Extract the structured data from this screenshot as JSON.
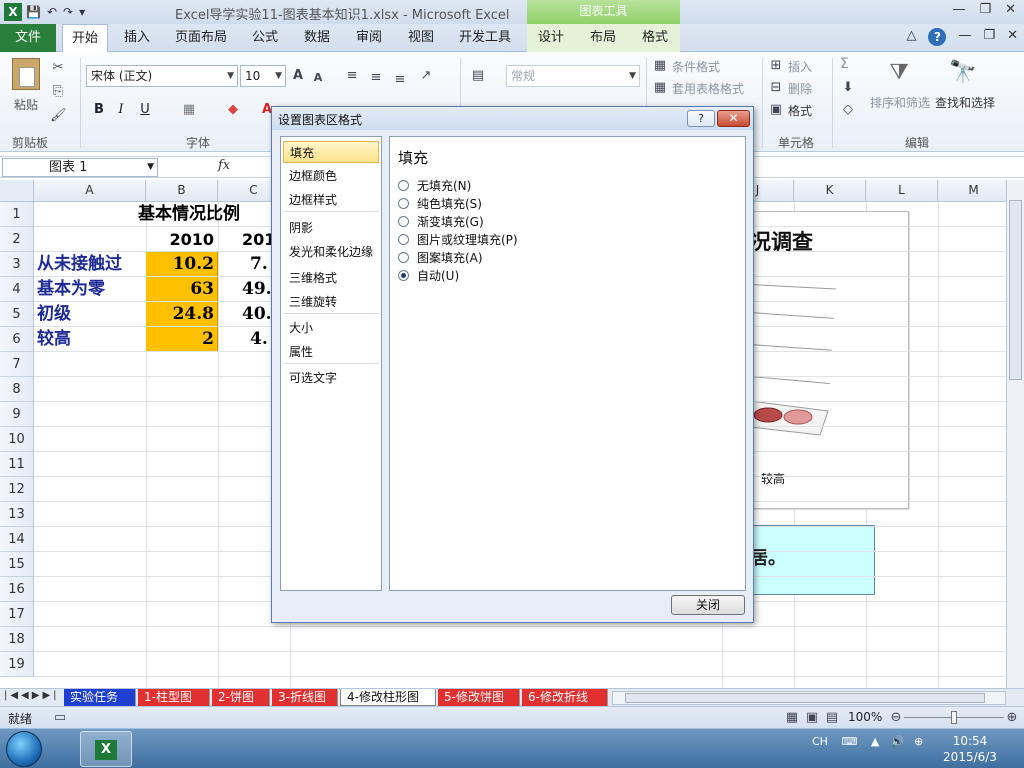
{
  "window": {
    "title": "Excel导学实验11-图表基本知识1.xlsx  -  Microsoft Excel",
    "context_group": "图表工具",
    "app_icon": "excel-icon"
  },
  "tabs": {
    "file": "文件",
    "home": "开始",
    "insert": "插入",
    "page_layout": "页面布局",
    "formulas": "公式",
    "data": "数据",
    "review": "审阅",
    "view": "视图",
    "developer": "开发工具",
    "design": "设计",
    "layout": "布局",
    "format": "格式"
  },
  "ribbon": {
    "paste": "粘贴",
    "clipboard": "剪贴板",
    "font_group": "字体",
    "font_name": "宋体 (正文)",
    "font_size": "10",
    "bold": "B",
    "italic": "I",
    "underline": "U",
    "number_format": "常规",
    "conditional_format": "条件格式",
    "table_format": "套用表格格式",
    "insert": "插入",
    "delete": "删除",
    "format": "格式",
    "cells_group": "单元格",
    "sort_filter": "排序和筛选",
    "find_select": "查找和选择",
    "edit_group": "编辑",
    "sigma": "Σ"
  },
  "formula_bar": {
    "name_box": "图表 1",
    "fx": "fx"
  },
  "grid": {
    "columns": [
      "A",
      "B",
      "C",
      "J",
      "K",
      "L",
      "M"
    ],
    "rows": [
      "1",
      "2",
      "3",
      "4",
      "5",
      "6",
      "7",
      "8",
      "9",
      "10",
      "11",
      "12",
      "13",
      "14",
      "15",
      "16",
      "17",
      "18",
      "19"
    ],
    "table_title": "基本情况比例",
    "year1": "2010",
    "year2": "201",
    "categories": [
      "从未接触过",
      "基本为零",
      "初级",
      "较高"
    ],
    "values_2010": [
      "10.2",
      "63",
      "24.8",
      "2"
    ],
    "values_col_c": [
      "7.",
      "49.",
      "40.",
      "4."
    ]
  },
  "chart": {
    "title_fragment": "况调查",
    "category_label": "较高",
    "note_fragment": "居。"
  },
  "sheet_tabs": {
    "items": [
      "实验任务",
      "1-柱型图",
      "2-饼图",
      "3-折线图",
      "4-修改柱形图",
      "5-修改饼图",
      "6-修改折线"
    ],
    "active_index": 4,
    "colors": [
      "#1f3fd0",
      "#e23030",
      "#e23030",
      "#e23030",
      "#ffffff",
      "#e23030",
      "#e23030"
    ]
  },
  "status": {
    "ready": "就绪",
    "zoom": "100%"
  },
  "taskbar": {
    "lang": "CH",
    "time": "10:54",
    "date": "2015/6/3"
  },
  "dialog": {
    "title": "设置图表区格式",
    "help": "?",
    "close_x": "✕",
    "nav": [
      "填充",
      "边框颜色",
      "边框样式",
      "阴影",
      "发光和柔化边缘",
      "三维格式",
      "三维旋转",
      "大小",
      "属性",
      "可选文字"
    ],
    "active_nav": 0,
    "panel_title": "填充",
    "options": [
      "无填充(N)",
      "纯色填充(S)",
      "渐变填充(G)",
      "图片或纹理填充(P)",
      "图案填充(A)",
      "自动(U)"
    ],
    "selected_option": 5,
    "close_button": "关闭"
  }
}
